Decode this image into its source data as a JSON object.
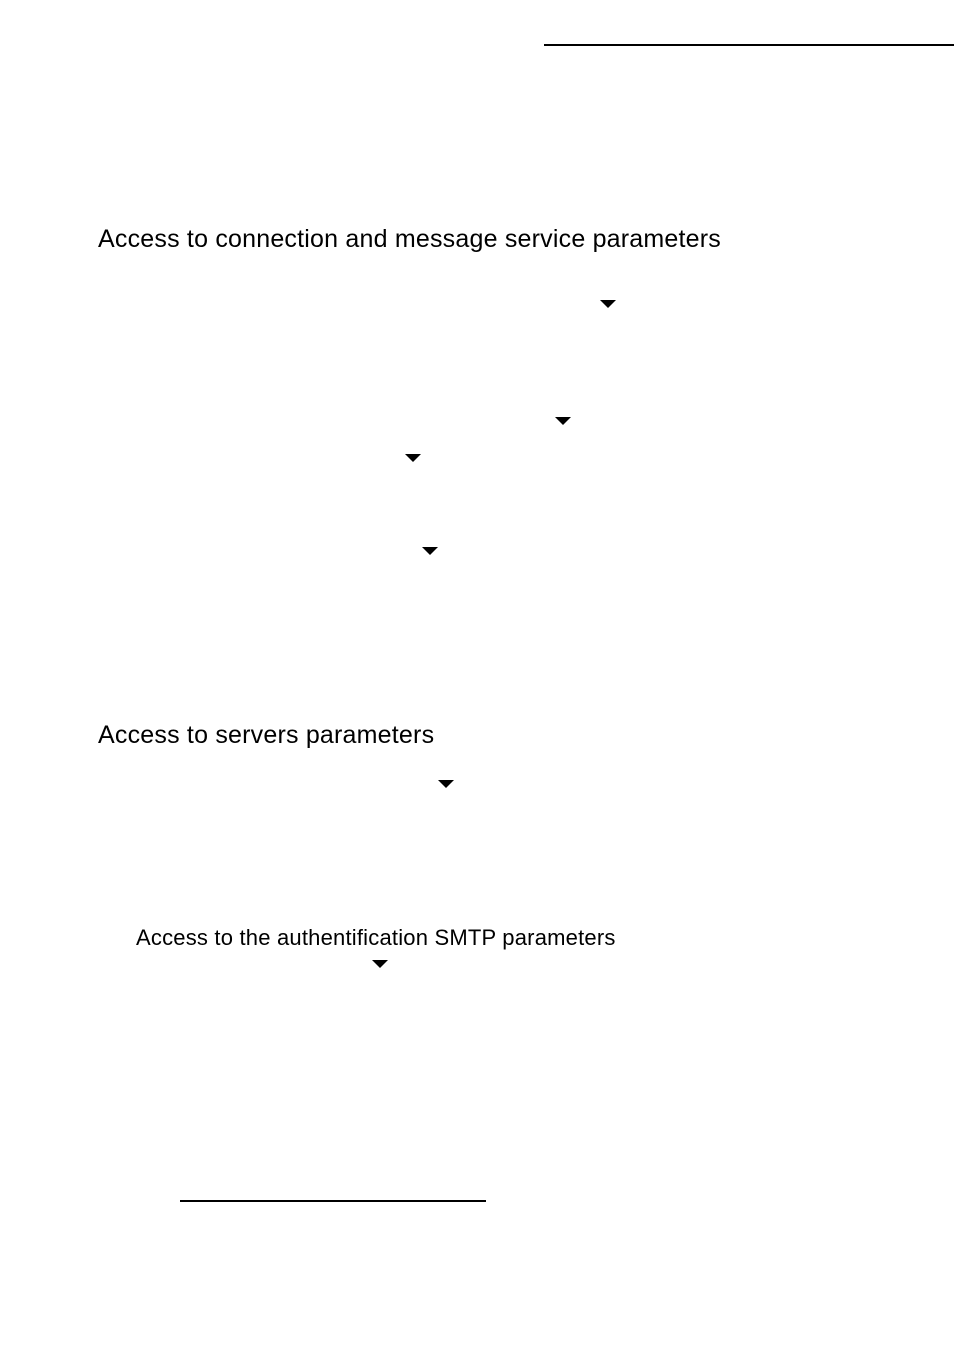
{
  "headings": {
    "h1": "Access to connection and message service parameters",
    "h2": "Access to servers parameters",
    "h3": "Access to the authentification SMTP parameters"
  }
}
